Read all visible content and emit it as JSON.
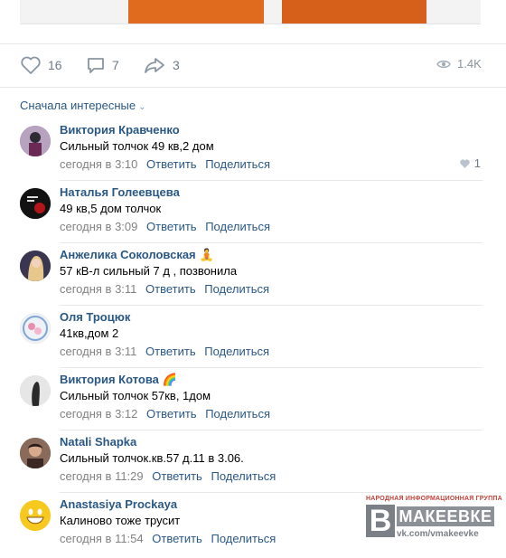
{
  "post": {
    "likes": "16",
    "comments": "7",
    "shares": "3",
    "views": "1.4K"
  },
  "sort": {
    "label": "Сначала интересные"
  },
  "comments": [
    {
      "author": "Виктория Кравченко",
      "text": "Сильный толчок 49 кв,2 дом",
      "time": "сегодня в 3:10",
      "reply": "Ответить",
      "share": "Поделиться",
      "likes": "1",
      "avatar_color": "#9b6a8e"
    },
    {
      "author": "Наталья Голеевцева",
      "text": "49 кв,5 дом толчок",
      "time": "сегодня в 3:09",
      "reply": "Ответить",
      "share": "Поделиться",
      "avatar_color": "#1a1a1a"
    },
    {
      "author": "Анжелика Соколовская",
      "emoji": "🧘",
      "text": "57 кВ-л сильный 7 д , позвонила",
      "time": "сегодня в 3:11",
      "reply": "Ответить",
      "share": "Поделиться",
      "avatar_color": "#3a3550"
    },
    {
      "author": "Оля Троцюк",
      "text": "41кв,дом 2",
      "time": "сегодня в 3:11",
      "reply": "Ответить",
      "share": "Поделиться",
      "avatar_color": "#e8b4c8"
    },
    {
      "author": "Виктория Котова",
      "emoji": "🌈",
      "text": "Сильный толчок 57кв, 1дом",
      "time": "сегодня в 3:12",
      "reply": "Ответить",
      "share": "Поделиться",
      "avatar_color": "#d9d9d9"
    },
    {
      "author": "Natali Shapka",
      "text": "Сильный толчок.кв.57 д.11 в 3.06.",
      "time": "сегодня в 11:29",
      "reply": "Ответить",
      "share": "Поделиться",
      "avatar_color": "#5a3a32"
    },
    {
      "author": "Anastasiya Prockaya",
      "text": "Калиново тоже трусит",
      "time": "сегодня в 11:54",
      "reply": "Ответить",
      "share": "Поделиться",
      "avatar_color": "#f5c518"
    }
  ],
  "watermark": {
    "top": "НАРОДНАЯ ИНФОРМАЦИОННАЯ ГРУППА",
    "letter": "В",
    "name": "МАКЕЕВКЕ",
    "url": "vk.com/vmakeevke"
  },
  "colors": {
    "link": "#2a5885",
    "meta": "#828282",
    "icon": "#6f7b88"
  }
}
